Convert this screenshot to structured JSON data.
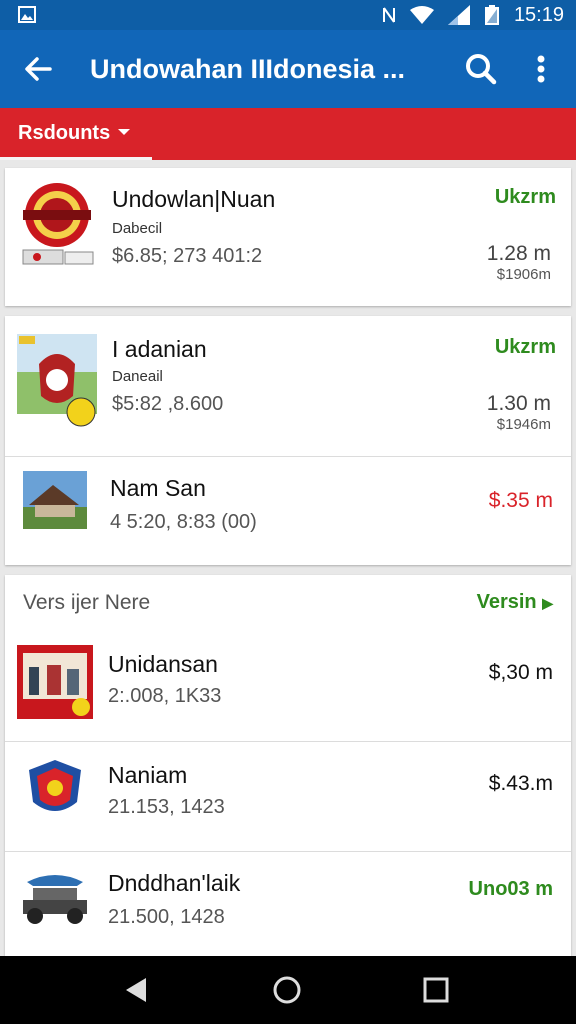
{
  "status_bar": {
    "time": "15:19"
  },
  "app_bar": {
    "title": "Undowahan IIIdonesia ..."
  },
  "tab": {
    "label": "Rsdounts"
  },
  "card1": {
    "title": "Undowlan|Nuan",
    "subtitle": "Dabecil",
    "price": "$6.85; 273 401:2",
    "right_tag": "Ukzrm",
    "right_value": "1.28 m",
    "right_small": "$1906m"
  },
  "card2": {
    "rows": [
      {
        "title": "I adanian",
        "subtitle": "Daneail",
        "price": "$5:82 ,8.600",
        "right_tag": "Ukzrm",
        "right_value": "1.30 m",
        "right_small": "$1946m"
      },
      {
        "title": "Nam San",
        "price": "4 5:20, 8:83 (00)",
        "right_value": "$.35 m"
      }
    ]
  },
  "section": {
    "label": "Vers ijer  Nere",
    "link": "Versin",
    "rows": [
      {
        "title": "Unidansan",
        "price": "2:.008, 1K33",
        "right_value": "$,30 m"
      },
      {
        "title": "Naniam",
        "price": "21.153, 1423",
        "right_value": "$.43.m"
      },
      {
        "title": "Dnddhan'laik",
        "price": "21.500, 1428",
        "right_value": "Uno03 m"
      }
    ]
  },
  "colors": {
    "app_bar": "#1166b8",
    "status_bar": "#0e5ea6",
    "tab_bar": "#d9232a",
    "accent_green": "#2e8b1e",
    "accent_red": "#d9232a"
  }
}
